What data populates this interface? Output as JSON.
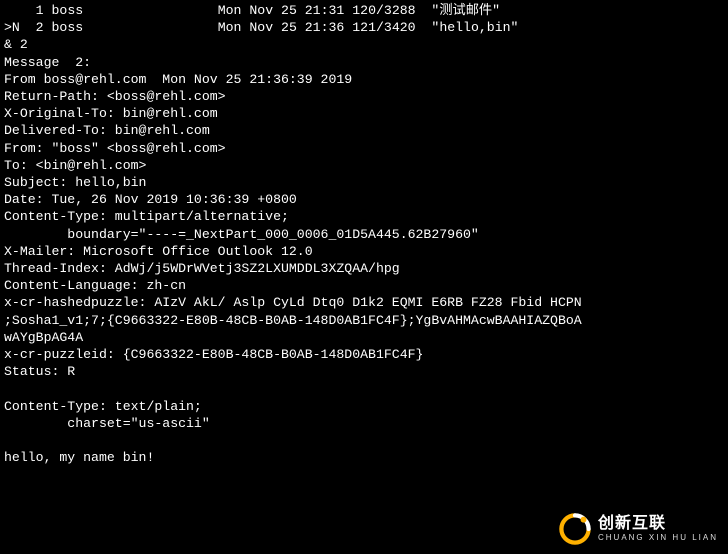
{
  "mail_list": {
    "rows": [
      {
        "flag": "   ",
        "num": "1",
        "from": "boss",
        "date": "Mon Nov 25 21:31",
        "size": "120/3288",
        "subject": "\"测试邮件\""
      },
      {
        "flag": ">N ",
        "num": "2",
        "from": "boss",
        "date": "Mon Nov 25 21:36",
        "size": "121/3420",
        "subject": "\"hello,bin\""
      }
    ]
  },
  "prompt_cmd": "& 2",
  "message_header": "Message  2:",
  "headers": {
    "envelope": "From boss@rehl.com  Mon Nov 25 21:36:39 2019",
    "return_path": "Return-Path: <boss@rehl.com>",
    "x_original_to": "X-Original-To: bin@rehl.com",
    "delivered_to": "Delivered-To: bin@rehl.com",
    "from": "From: \"boss\" <boss@rehl.com>",
    "to": "To: <bin@rehl.com>",
    "subject": "Subject: hello,bin",
    "date": "Date: Tue, 26 Nov 2019 10:36:39 +0800",
    "content_type": "Content-Type: multipart/alternative;",
    "boundary": "        boundary=\"----=_NextPart_000_0006_01D5A445.62B27960\"",
    "x_mailer": "X-Mailer: Microsoft Office Outlook 12.0",
    "thread_index": "Thread-Index: AdWj/j5WDrWVetj3SZ2LXUMDDL3XZQAA/hpg",
    "content_language": "Content-Language: zh-cn",
    "x_cr_hashedpuzzle": "x-cr-hashedpuzzle: AIzV AkL/ Aslp CyLd Dtq0 D1k2 EQMI E6RB FZ28 Fbid HCPN",
    "x_cr_hashedpuzzle2": ";Sosha1_v1;7;{C9663322-E80B-48CB-B0AB-148D0AB1FC4F};YgBvAHMAcwBAAHIAZQBoA",
    "x_cr_hashedpuzzle3": "wAYgBpAG4A",
    "x_cr_puzzleid": "x-cr-puzzleid: {C9663322-E80B-48CB-B0AB-148D0AB1FC4F}",
    "status": "Status: R"
  },
  "body": {
    "content_type": "Content-Type: text/plain;",
    "charset": "        charset=\"us-ascii\"",
    "text": "hello, my name bin!"
  },
  "watermark": {
    "zh": "创新互联",
    "py": "CHUANG XIN HU LIAN"
  }
}
